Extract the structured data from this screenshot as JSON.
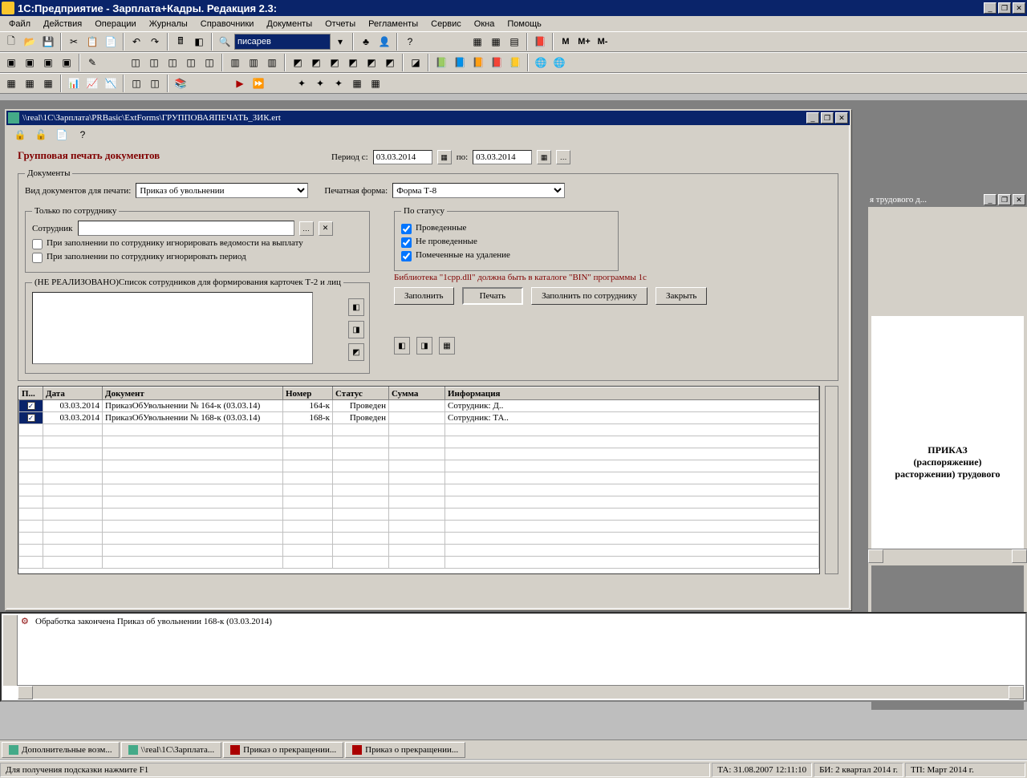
{
  "title": "1С:Предприятие - Зарплата+Кадры. Редакция 2.3:",
  "menu": [
    "Файл",
    "Действия",
    "Операции",
    "Журналы",
    "Справочники",
    "Документы",
    "Отчеты",
    "Регламенты",
    "Сервис",
    "Окна",
    "Помощь"
  ],
  "combo_value": "писарев",
  "inner": {
    "title": "\\\\real\\1C\\Зарплата\\PRBasic\\ExtForms\\ГРУППОВАЯПЕЧАТЬ_ЗИК.ert",
    "form_title": "Групповая печать документов",
    "period_label": "Период с:",
    "period_from": "03.03.2014",
    "period_to_label": "по:",
    "period_to": "03.03.2014",
    "docs_legend": "Документы",
    "doc_type_label": "Вид документов для печати:",
    "doc_type_value": "Приказ об увольнении",
    "print_form_label": "Печатная форма:",
    "print_form_value": "Форма Т-8",
    "only_emp_legend": "Только по сотруднику",
    "emp_label": "Сотрудник",
    "chk_ignore_ved": "При заполнении по сотруднику игнорировать ведомости на выплату",
    "chk_ignore_period": "При заполнении по сотруднику игнорировать период",
    "unreal_legend": "(НЕ РЕАЛИЗОВАНО)Список сотрудников для формирования карточек Т-2 и лиц",
    "status_legend": "По статусу",
    "chk_prov": "Проведенные",
    "chk_neprov": "Не проведенные",
    "chk_del": "Помеченные на удаление",
    "warn": "Библиотека \"1cpp.dll\" должна быть в каталоге \"BIN\" программы 1с",
    "btn_fill": "Заполнить",
    "btn_print": "Печать",
    "btn_fill_emp": "Заполнить по сотруднику",
    "btn_close": "Закрыть",
    "grid": {
      "headers": [
        "П...",
        "Дата",
        "Документ",
        "Номер",
        "Статус",
        "Сумма",
        "Информация"
      ],
      "rows": [
        {
          "chk": "✓",
          "date": "03.03.2014",
          "doc": "ПриказОбУвольнении № 164-к (03.03.14)",
          "num": "164-к",
          "status": "Проведен",
          "sum": "",
          "info": "Сотрудник: Д.."
        },
        {
          "chk": "✓",
          "date": "03.03.2014",
          "doc": "ПриказОбУвольнении № 168-к (03.03.14)",
          "num": "168-к",
          "status": "Проведен",
          "sum": "",
          "info": "Сотрудник: ТА.."
        }
      ]
    }
  },
  "doc2": {
    "tab_title": "я трудового д...",
    "heading": "ПРИКАЗ",
    "sub1": "(распоряжение)",
    "sub2": "расторжении) трудового"
  },
  "log": "Обработка закончена Приказ об увольнении 168-к (03.03.2014)",
  "wintabs": [
    "Дополнительные возм...",
    "\\\\real\\1C\\Зарплата...",
    "Приказ о прекращении...",
    "Приказ о прекращении..."
  ],
  "status": {
    "hint": "Для получения подсказки нажмите F1",
    "ta": "ТА: 31.08.2007  12:11:10",
    "bi": "БИ: 2 квартал 2014 г.",
    "tp": "ТП: Март 2014 г."
  }
}
